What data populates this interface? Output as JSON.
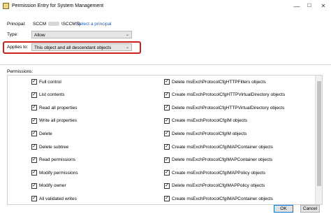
{
  "window": {
    "title": "Permission Entry for System Management",
    "min_glyph": "—",
    "max_glyph": "☐",
    "close_glyph": "✕"
  },
  "principal": {
    "label": "Principal:",
    "value_prefix": "SCCM",
    "value_suffix": "\\SCCMS)",
    "select_link": "Select a principal"
  },
  "type": {
    "label": "Type:",
    "value": "Allow"
  },
  "applies_to": {
    "label": "Applies to:",
    "value": "This object and all descendant objects",
    "highlight_color": "#d0201e"
  },
  "permissions": {
    "header": "Permissions:",
    "check_glyph": "✓",
    "left": [
      {
        "label": "Full control",
        "checked": true
      },
      {
        "label": "List contents",
        "checked": true
      },
      {
        "label": "Read all properties",
        "checked": true
      },
      {
        "label": "Write all properties",
        "checked": true
      },
      {
        "label": "Delete",
        "checked": true
      },
      {
        "label": "Delete subtree",
        "checked": true
      },
      {
        "label": "Read permissions",
        "checked": true
      },
      {
        "label": "Modify permissions",
        "checked": true
      },
      {
        "label": "Modify owner",
        "checked": true
      },
      {
        "label": "All validated writes",
        "checked": true
      }
    ],
    "right": [
      {
        "label": "Delete msExchProtocolCfgHTTPFilters objects",
        "checked": true
      },
      {
        "label": "Create msExchProtocolCfgHTTPVirtualDirectory objects",
        "checked": true
      },
      {
        "label": "Delete msExchProtocolCfgHTTPVirtualDirectory objects",
        "checked": true
      },
      {
        "label": "Create msExchProtocolCfgIM objects",
        "checked": true
      },
      {
        "label": "Delete msExchProtocolCfgIM objects",
        "checked": true
      },
      {
        "label": "Create msExchProtocolCfgIMAPContainer objects",
        "checked": true
      },
      {
        "label": "Delete msExchProtocolCfgIMAPContainer objects",
        "checked": true
      },
      {
        "label": "Create msExchProtocolCfgIMAPPolicy objects",
        "checked": true
      },
      {
        "label": "Delete msExchProtocolCfgIMAPPolicy objects",
        "checked": true
      },
      {
        "label": "Create msExchProtocolCfgIMAPContainer objects",
        "checked": true
      }
    ]
  },
  "buttons": {
    "ok": "OK",
    "cancel": "Cancel"
  },
  "colors": {
    "link": "#1a5cc5",
    "combo_bg": "#e5e5e5"
  }
}
